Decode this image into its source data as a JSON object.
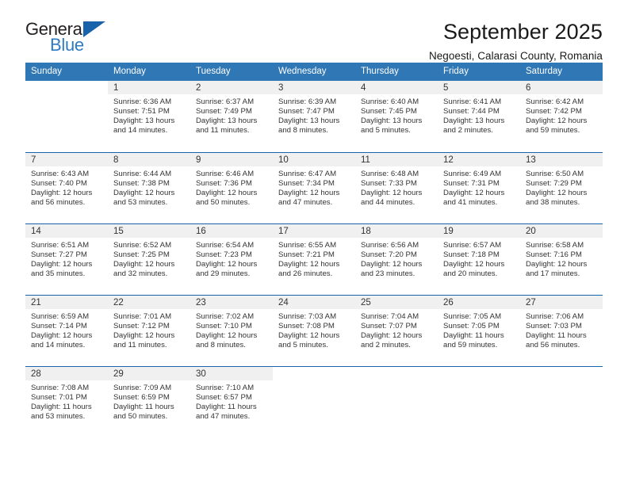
{
  "brand": {
    "word_one": "General",
    "word_two": "Blue",
    "triangle_icon": "triangle-icon",
    "accent_color": "#1963ab",
    "blue_text_color": "#2e7bc4"
  },
  "header": {
    "title": "September 2025",
    "subtitle": "Negoesti, Calarasi County, Romania"
  },
  "calendar": {
    "header_bg": "#3077b5",
    "header_text_color": "#ffffff",
    "week_separator_color": "#1963ab",
    "day_band_bg": "#f0f0f0",
    "weekdays": [
      "Sunday",
      "Monday",
      "Tuesday",
      "Wednesday",
      "Thursday",
      "Friday",
      "Saturday"
    ],
    "weeks": [
      [
        {
          "day": "",
          "sunrise": "",
          "sunset": "",
          "daylight_line1": "",
          "daylight_line2": ""
        },
        {
          "day": "1",
          "sunrise": "Sunrise: 6:36 AM",
          "sunset": "Sunset: 7:51 PM",
          "daylight_line1": "Daylight: 13 hours",
          "daylight_line2": "and 14 minutes."
        },
        {
          "day": "2",
          "sunrise": "Sunrise: 6:37 AM",
          "sunset": "Sunset: 7:49 PM",
          "daylight_line1": "Daylight: 13 hours",
          "daylight_line2": "and 11 minutes."
        },
        {
          "day": "3",
          "sunrise": "Sunrise: 6:39 AM",
          "sunset": "Sunset: 7:47 PM",
          "daylight_line1": "Daylight: 13 hours",
          "daylight_line2": "and 8 minutes."
        },
        {
          "day": "4",
          "sunrise": "Sunrise: 6:40 AM",
          "sunset": "Sunset: 7:45 PM",
          "daylight_line1": "Daylight: 13 hours",
          "daylight_line2": "and 5 minutes."
        },
        {
          "day": "5",
          "sunrise": "Sunrise: 6:41 AM",
          "sunset": "Sunset: 7:44 PM",
          "daylight_line1": "Daylight: 13 hours",
          "daylight_line2": "and 2 minutes."
        },
        {
          "day": "6",
          "sunrise": "Sunrise: 6:42 AM",
          "sunset": "Sunset: 7:42 PM",
          "daylight_line1": "Daylight: 12 hours",
          "daylight_line2": "and 59 minutes."
        }
      ],
      [
        {
          "day": "7",
          "sunrise": "Sunrise: 6:43 AM",
          "sunset": "Sunset: 7:40 PM",
          "daylight_line1": "Daylight: 12 hours",
          "daylight_line2": "and 56 minutes."
        },
        {
          "day": "8",
          "sunrise": "Sunrise: 6:44 AM",
          "sunset": "Sunset: 7:38 PM",
          "daylight_line1": "Daylight: 12 hours",
          "daylight_line2": "and 53 minutes."
        },
        {
          "day": "9",
          "sunrise": "Sunrise: 6:46 AM",
          "sunset": "Sunset: 7:36 PM",
          "daylight_line1": "Daylight: 12 hours",
          "daylight_line2": "and 50 minutes."
        },
        {
          "day": "10",
          "sunrise": "Sunrise: 6:47 AM",
          "sunset": "Sunset: 7:34 PM",
          "daylight_line1": "Daylight: 12 hours",
          "daylight_line2": "and 47 minutes."
        },
        {
          "day": "11",
          "sunrise": "Sunrise: 6:48 AM",
          "sunset": "Sunset: 7:33 PM",
          "daylight_line1": "Daylight: 12 hours",
          "daylight_line2": "and 44 minutes."
        },
        {
          "day": "12",
          "sunrise": "Sunrise: 6:49 AM",
          "sunset": "Sunset: 7:31 PM",
          "daylight_line1": "Daylight: 12 hours",
          "daylight_line2": "and 41 minutes."
        },
        {
          "day": "13",
          "sunrise": "Sunrise: 6:50 AM",
          "sunset": "Sunset: 7:29 PM",
          "daylight_line1": "Daylight: 12 hours",
          "daylight_line2": "and 38 minutes."
        }
      ],
      [
        {
          "day": "14",
          "sunrise": "Sunrise: 6:51 AM",
          "sunset": "Sunset: 7:27 PM",
          "daylight_line1": "Daylight: 12 hours",
          "daylight_line2": "and 35 minutes."
        },
        {
          "day": "15",
          "sunrise": "Sunrise: 6:52 AM",
          "sunset": "Sunset: 7:25 PM",
          "daylight_line1": "Daylight: 12 hours",
          "daylight_line2": "and 32 minutes."
        },
        {
          "day": "16",
          "sunrise": "Sunrise: 6:54 AM",
          "sunset": "Sunset: 7:23 PM",
          "daylight_line1": "Daylight: 12 hours",
          "daylight_line2": "and 29 minutes."
        },
        {
          "day": "17",
          "sunrise": "Sunrise: 6:55 AM",
          "sunset": "Sunset: 7:21 PM",
          "daylight_line1": "Daylight: 12 hours",
          "daylight_line2": "and 26 minutes."
        },
        {
          "day": "18",
          "sunrise": "Sunrise: 6:56 AM",
          "sunset": "Sunset: 7:20 PM",
          "daylight_line1": "Daylight: 12 hours",
          "daylight_line2": "and 23 minutes."
        },
        {
          "day": "19",
          "sunrise": "Sunrise: 6:57 AM",
          "sunset": "Sunset: 7:18 PM",
          "daylight_line1": "Daylight: 12 hours",
          "daylight_line2": "and 20 minutes."
        },
        {
          "day": "20",
          "sunrise": "Sunrise: 6:58 AM",
          "sunset": "Sunset: 7:16 PM",
          "daylight_line1": "Daylight: 12 hours",
          "daylight_line2": "and 17 minutes."
        }
      ],
      [
        {
          "day": "21",
          "sunrise": "Sunrise: 6:59 AM",
          "sunset": "Sunset: 7:14 PM",
          "daylight_line1": "Daylight: 12 hours",
          "daylight_line2": "and 14 minutes."
        },
        {
          "day": "22",
          "sunrise": "Sunrise: 7:01 AM",
          "sunset": "Sunset: 7:12 PM",
          "daylight_line1": "Daylight: 12 hours",
          "daylight_line2": "and 11 minutes."
        },
        {
          "day": "23",
          "sunrise": "Sunrise: 7:02 AM",
          "sunset": "Sunset: 7:10 PM",
          "daylight_line1": "Daylight: 12 hours",
          "daylight_line2": "and 8 minutes."
        },
        {
          "day": "24",
          "sunrise": "Sunrise: 7:03 AM",
          "sunset": "Sunset: 7:08 PM",
          "daylight_line1": "Daylight: 12 hours",
          "daylight_line2": "and 5 minutes."
        },
        {
          "day": "25",
          "sunrise": "Sunrise: 7:04 AM",
          "sunset": "Sunset: 7:07 PM",
          "daylight_line1": "Daylight: 12 hours",
          "daylight_line2": "and 2 minutes."
        },
        {
          "day": "26",
          "sunrise": "Sunrise: 7:05 AM",
          "sunset": "Sunset: 7:05 PM",
          "daylight_line1": "Daylight: 11 hours",
          "daylight_line2": "and 59 minutes."
        },
        {
          "day": "27",
          "sunrise": "Sunrise: 7:06 AM",
          "sunset": "Sunset: 7:03 PM",
          "daylight_line1": "Daylight: 11 hours",
          "daylight_line2": "and 56 minutes."
        }
      ],
      [
        {
          "day": "28",
          "sunrise": "Sunrise: 7:08 AM",
          "sunset": "Sunset: 7:01 PM",
          "daylight_line1": "Daylight: 11 hours",
          "daylight_line2": "and 53 minutes."
        },
        {
          "day": "29",
          "sunrise": "Sunrise: 7:09 AM",
          "sunset": "Sunset: 6:59 PM",
          "daylight_line1": "Daylight: 11 hours",
          "daylight_line2": "and 50 minutes."
        },
        {
          "day": "30",
          "sunrise": "Sunrise: 7:10 AM",
          "sunset": "Sunset: 6:57 PM",
          "daylight_line1": "Daylight: 11 hours",
          "daylight_line2": "and 47 minutes."
        },
        {
          "day": "",
          "sunrise": "",
          "sunset": "",
          "daylight_line1": "",
          "daylight_line2": ""
        },
        {
          "day": "",
          "sunrise": "",
          "sunset": "",
          "daylight_line1": "",
          "daylight_line2": ""
        },
        {
          "day": "",
          "sunrise": "",
          "sunset": "",
          "daylight_line1": "",
          "daylight_line2": ""
        },
        {
          "day": "",
          "sunrise": "",
          "sunset": "",
          "daylight_line1": "",
          "daylight_line2": ""
        }
      ]
    ]
  }
}
